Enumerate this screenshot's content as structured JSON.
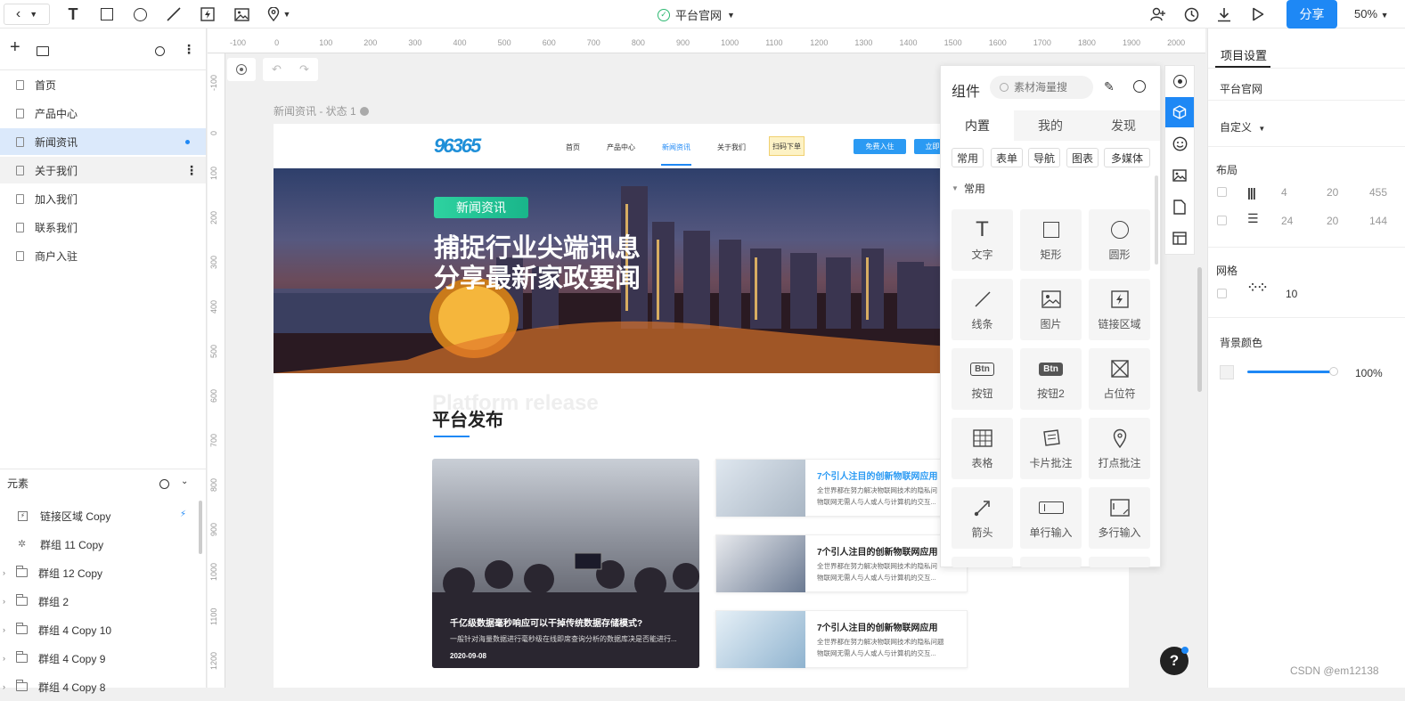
{
  "toolbar": {
    "project_name": "平台官网",
    "share_label": "分享",
    "zoom": "50%"
  },
  "pages": [
    "首页",
    "产品中心",
    "新闻资讯",
    "关于我们",
    "加入我们",
    "联系我们",
    "商户入驻"
  ],
  "elements_header": "元素",
  "elements": [
    "链接区域 Copy",
    "群组 11 Copy",
    "群组 12 Copy",
    "群组 2",
    "群组 4 Copy 10",
    "群组 4 Copy 9",
    "群组 4 Copy 8"
  ],
  "ruler": {
    "h": [
      "-100",
      "0",
      "100",
      "200",
      "300",
      "400",
      "500",
      "600",
      "700",
      "800",
      "900",
      "1000",
      "1100",
      "1200",
      "1300",
      "1400",
      "1500",
      "1600",
      "1700",
      "1800",
      "1900",
      "2000"
    ],
    "v": [
      "-100",
      "0",
      "100",
      "200",
      "300",
      "400",
      "500",
      "600",
      "700",
      "800",
      "900",
      "1000",
      "1100",
      "1200"
    ]
  },
  "board": {
    "state_label": "新闻资讯 - 状态 1",
    "logo": "96365",
    "nav": [
      "首页",
      "产品中心",
      "新闻资讯",
      "关于我们",
      "扫码下单"
    ],
    "btn_free": "免费入住",
    "btn_now": "立即",
    "hero_tag": "新闻资讯",
    "hero_line1": "捕捉行业尖端讯息",
    "hero_line2": "分享最新家政要闻",
    "section_bg": "Platform release",
    "section_title": "平台发布",
    "feature_title": "千亿级数据毫秒响应可以干掉传统数据存储模式?",
    "feature_desc": "一般针对海量数据进行毫秒级在线即席查询分析的数据库决是否能进行...",
    "feature_date": "2020-09-08",
    "news": [
      {
        "title": "7个引人注目的创新物联网应用",
        "desc1": "全世界都在努力解决物联网技术的隐私问",
        "desc2": "物联网无需人与人或人与计算机的交互..."
      },
      {
        "title": "7个引人注目的创新物联网应用",
        "desc1": "全世界都在努力解决物联网技术的隐私问",
        "desc2": "物联网无需人与人或人与计算机的交互..."
      },
      {
        "title": "7个引人注目的创新物联网应用",
        "desc1": "全世界都在努力解决物联网技术的隐私问题",
        "desc2": "物联网无需人与人或人与计算机的交互..."
      }
    ]
  },
  "components": {
    "title": "组件",
    "search_placeholder": "素材海量搜",
    "tabs": [
      "内置",
      "我的",
      "发现"
    ],
    "chips": [
      "常用",
      "表单",
      "导航",
      "图表",
      "多媒体"
    ],
    "group": "常用",
    "items": [
      "文字",
      "矩形",
      "圆形",
      "线条",
      "图片",
      "链接区域",
      "按钮",
      "按钮2",
      "占位符",
      "表格",
      "卡片批注",
      "打点批注",
      "箭头",
      "单行输入",
      "多行输入"
    ],
    "btn_glyph": "Btn"
  },
  "right": {
    "tab": "项目设置",
    "name": "平台官网",
    "size_mode": "自定义",
    "layout_label": "布局",
    "layout_rows": [
      [
        "4",
        "20",
        "455"
      ],
      [
        "24",
        "20",
        "144"
      ]
    ],
    "grid_label": "网格",
    "grid_value": "10",
    "bg_label": "背景颜色",
    "bg_opacity": "100%"
  },
  "watermark": "CSDN @em12138",
  "help": "?"
}
